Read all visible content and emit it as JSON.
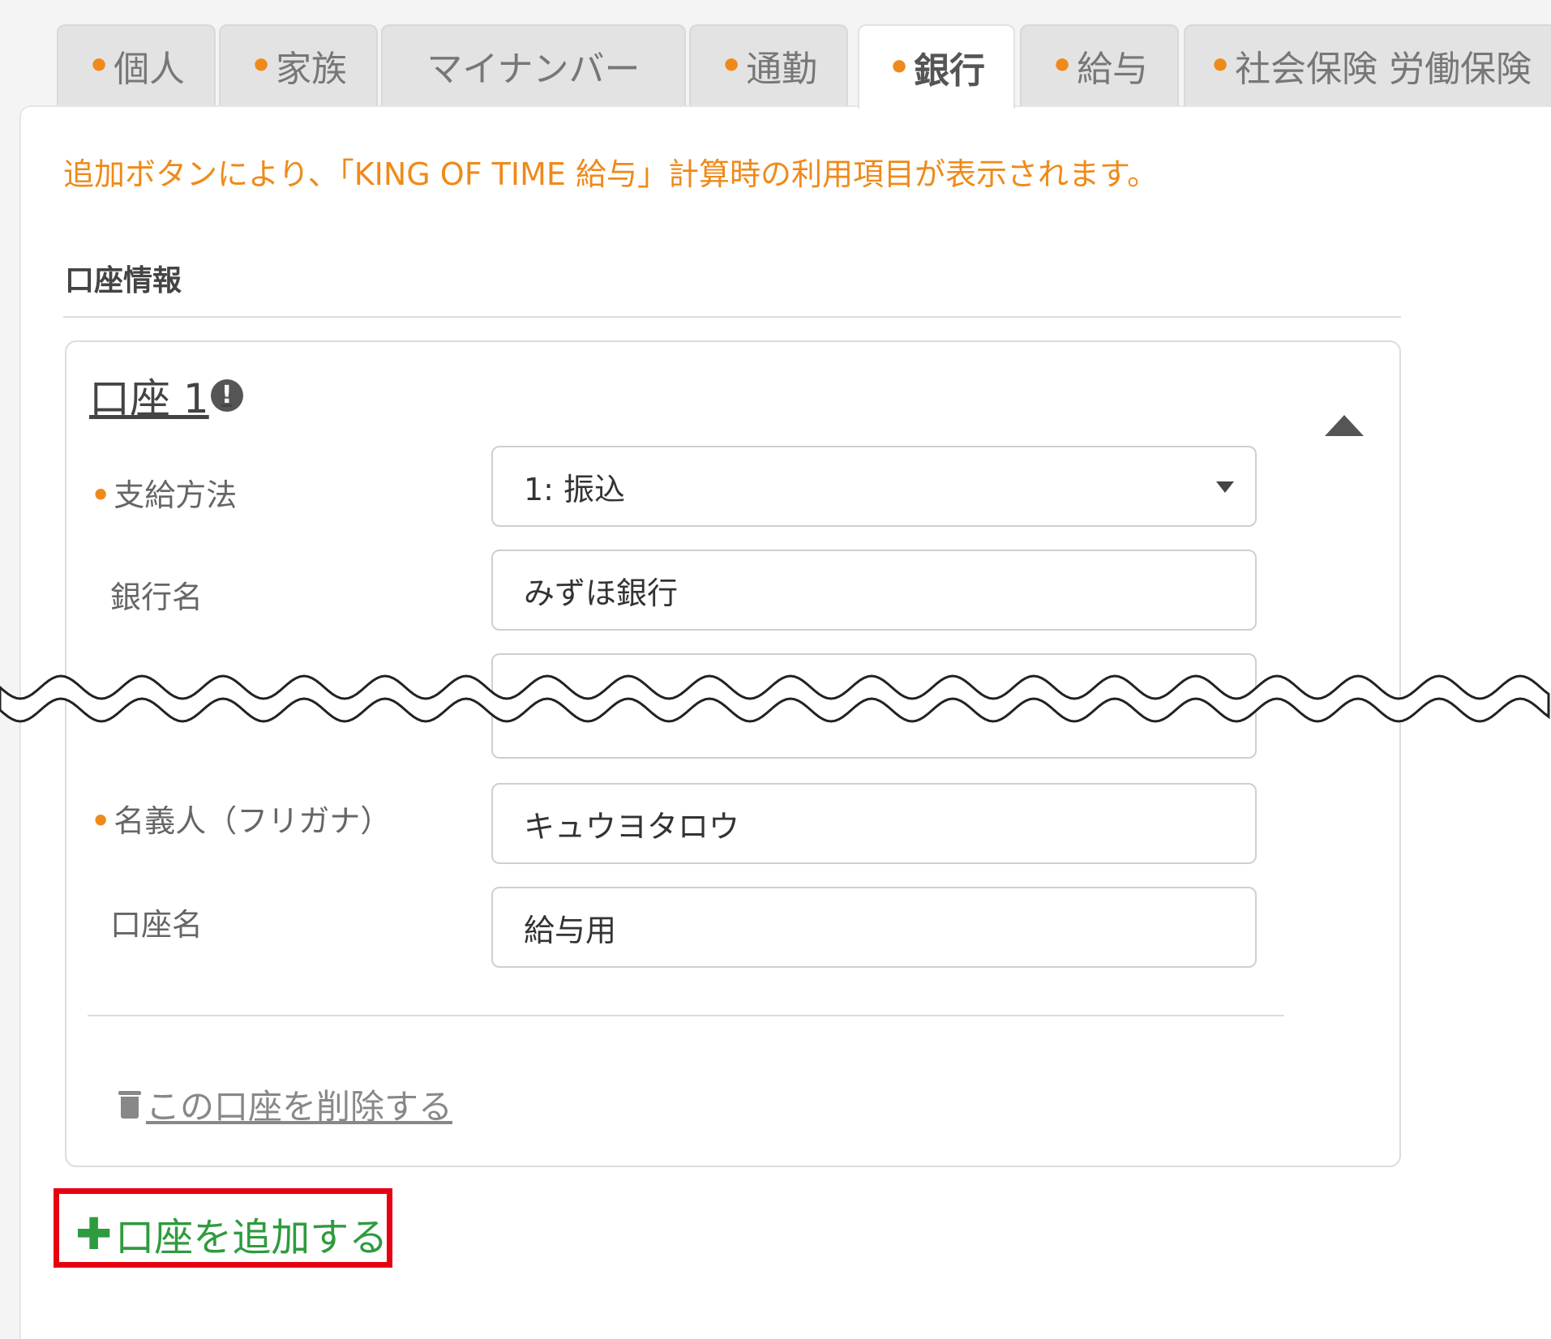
{
  "tabs": [
    {
      "label": "個人",
      "required": true
    },
    {
      "label": "家族",
      "required": true
    },
    {
      "label": "マイナンバー",
      "required": false
    },
    {
      "label": "通勤",
      "required": true
    },
    {
      "label": "銀行",
      "required": true,
      "active": true
    },
    {
      "label": "給与",
      "required": true
    },
    {
      "label": "社会保険 労働保険",
      "required": true
    }
  ],
  "notice": "追加ボタンにより、「KING OF TIME 給与」計算時の利用項目が表示されます。",
  "section_title": "口座情報",
  "account": {
    "title": "口座 1",
    "alert_glyph": "!",
    "fields": {
      "payment_method": {
        "label": "支給方法",
        "value": "1: 振込"
      },
      "bank_name": {
        "label": "銀行名",
        "value": "みずほ銀行"
      },
      "holder_kana": {
        "label": "名義人（フリガナ）",
        "value": "キュウヨタロウ"
      },
      "account_name": {
        "label": "口座名",
        "value": "給与用"
      }
    },
    "delete_label": "この口座を削除する"
  },
  "add_label": "口座を追加する",
  "colors": {
    "accent_orange": "#ef8a1a",
    "add_green": "#2e9b3e",
    "highlight_red": "#e60012"
  }
}
